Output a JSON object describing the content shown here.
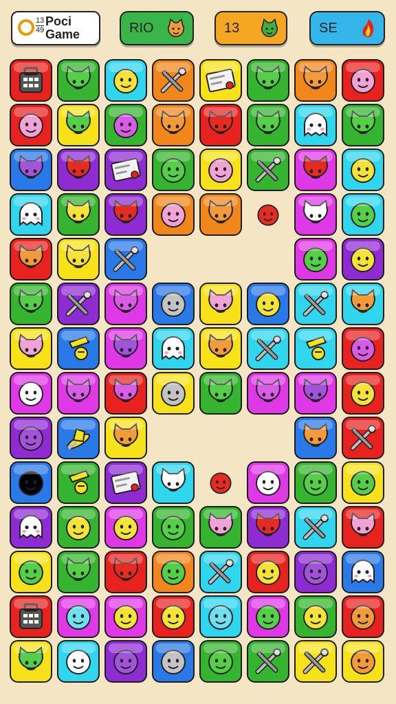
{
  "header": {
    "title_line1": "Poci",
    "title_line2": "Game",
    "logo_score_top": "13",
    "logo_score_bottom": "49",
    "pills": [
      {
        "label": "RIO",
        "color": "#39b54a",
        "icon": "cat-face-icon"
      },
      {
        "label": "13",
        "color": "#f5a623",
        "icon": "cat-face-icon"
      },
      {
        "label": "SE",
        "color": "#35b6ea",
        "icon": "flame-icon"
      }
    ]
  },
  "colors": {
    "red": "#e8231f",
    "green": "#35b52f",
    "cyan": "#2fd6ee",
    "orange": "#f1861b",
    "yellow": "#f7e21a",
    "magenta": "#df38e6",
    "purple": "#8e2bd3",
    "blue": "#2a79e8",
    "face_yellow": "#f6e338",
    "face_pink": "#f2a3d6",
    "face_white": "#ffffff",
    "face_grey": "#c3c3c3",
    "face_orange": "#f39a3a",
    "face_green": "#55cf48",
    "face_red": "#e62b22",
    "face_magenta": "#d85ce6",
    "face_purple": "#a153d9",
    "face_cyan": "#6fe0f0"
  },
  "board": {
    "rows": [
      [
        [
          "red",
          "icon-bag"
        ],
        [
          "green",
          "cat-face",
          "face_green"
        ],
        [
          "cyan",
          "smile-face",
          "face_yellow"
        ],
        [
          "orange",
          "icon-tools"
        ],
        [
          "yellow",
          "icon-card"
        ],
        [
          "green",
          "cat-face",
          "face_green"
        ],
        [
          "orange",
          "cat-face",
          "face_orange"
        ],
        [
          "red",
          "smile-face",
          "face_pink"
        ]
      ],
      [
        [
          "red",
          "smile-face",
          "face_pink"
        ],
        [
          "yellow",
          "cat-face",
          "face_green"
        ],
        [
          "green",
          "smile-face",
          "face_magenta"
        ],
        [
          "orange",
          "cat-face",
          "face_orange"
        ],
        [
          "red",
          "cat-face",
          "face_red"
        ],
        [
          "green",
          "cat-face",
          "face_green"
        ],
        [
          "cyan",
          "ghost-face",
          "face_white"
        ],
        [
          "green",
          "cat-face",
          "face_green"
        ]
      ],
      [
        [
          "blue",
          "cat-face",
          "face_purple"
        ],
        [
          "purple",
          "cat-face",
          "face_red"
        ],
        [
          "purple",
          "icon-card"
        ],
        [
          "green",
          "smile-face",
          "face_green"
        ],
        [
          "yellow",
          "smile-face",
          "face_pink"
        ],
        [
          "green",
          "icon-tools"
        ],
        [
          "magenta",
          "cat-face",
          "face_red"
        ],
        [
          "cyan",
          "smile-face",
          "face_yellow"
        ]
      ],
      [
        [
          "cyan",
          "ghost-face",
          "face_white"
        ],
        [
          "green",
          "cat-face",
          "face_yellow"
        ],
        [
          "purple",
          "cat-face",
          "face_red"
        ],
        [
          "orange",
          "smile-face",
          "face_pink"
        ],
        [
          "orange",
          "cat-face",
          "face_orange"
        ],
        null,
        [
          "magenta",
          "cat-face",
          "face_white"
        ],
        [
          "cyan",
          "smile-face",
          "face_green"
        ]
      ],
      [
        [
          "red",
          "cat-face",
          "face_orange"
        ],
        [
          "yellow",
          "cat-face",
          "face_yellow"
        ],
        [
          "blue",
          "icon-tools"
        ],
        null,
        null,
        null,
        [
          "magenta",
          "smile-face",
          "face_green"
        ],
        [
          "purple",
          "smile-face",
          "face_yellow"
        ]
      ],
      [
        [
          "green",
          "cat-face",
          "face_green"
        ],
        [
          "purple",
          "icon-tools"
        ],
        [
          "magenta",
          "cat-face",
          "face_magenta"
        ],
        [
          "blue",
          "smile-face",
          "face_grey"
        ],
        [
          "yellow",
          "cat-face",
          "face_pink"
        ],
        [
          "blue",
          "smile-face",
          "face_yellow"
        ],
        [
          "cyan",
          "icon-tools"
        ],
        [
          "cyan",
          "cat-face",
          "face_orange"
        ]
      ],
      [
        [
          "yellow",
          "cat-face",
          "face_pink"
        ],
        [
          "blue",
          "icon-bell"
        ],
        [
          "magenta",
          "cat-face",
          "face_purple"
        ],
        [
          "cyan",
          "ghost-face",
          "face_white"
        ],
        [
          "yellow",
          "cat-face",
          "face_orange"
        ],
        [
          "cyan",
          "icon-tools"
        ],
        [
          "cyan",
          "icon-bell"
        ],
        [
          "red",
          "smile-face",
          "face_magenta"
        ]
      ],
      [
        [
          "magenta",
          "smile-face",
          "face_white"
        ],
        [
          "magenta",
          "cat-face",
          "face_magenta"
        ],
        [
          "red",
          "cat-face",
          "face_magenta"
        ],
        [
          "yellow",
          "smile-face",
          "face_grey"
        ],
        [
          "green",
          "cat-face",
          "face_green"
        ],
        [
          "magenta",
          "cat-face",
          "face_magenta"
        ],
        [
          "magenta",
          "cat-face",
          "face_purple"
        ],
        [
          "red",
          "smile-face",
          "face_yellow"
        ]
      ],
      [
        [
          "purple",
          "smile-face",
          "face_purple"
        ],
        [
          "blue",
          "icon-hat"
        ],
        [
          "yellow",
          "cat-face",
          "face_orange"
        ],
        null,
        null,
        null,
        [
          "blue",
          "cat-face",
          "face_orange"
        ],
        [
          "red",
          "icon-tools"
        ]
      ],
      [
        [
          "blue",
          "smile-face",
          "face_blue"
        ],
        [
          "green",
          "icon-bell"
        ],
        [
          "purple",
          "icon-card"
        ],
        [
          "cyan",
          "cat-face",
          "face_white"
        ],
        null,
        [
          "magenta",
          "smile-face",
          "face_white"
        ],
        [
          "green",
          "smile-face",
          "face_green"
        ],
        [
          "yellow",
          "smile-face",
          "face_green"
        ]
      ],
      [
        [
          "purple",
          "ghost-face",
          "face_white"
        ],
        [
          "green",
          "smile-face",
          "face_yellow"
        ],
        [
          "magenta",
          "smile-face",
          "face_yellow"
        ],
        [
          "green",
          "smile-face",
          "face_green"
        ],
        [
          "green",
          "cat-face",
          "face_pink"
        ],
        [
          "purple",
          "cat-face",
          "face_red"
        ],
        [
          "cyan",
          "icon-tools"
        ],
        [
          "red",
          "cat-face",
          "face_pink"
        ]
      ],
      [
        [
          "yellow",
          "smile-face",
          "face_green"
        ],
        [
          "green",
          "cat-face",
          "face_green"
        ],
        [
          "red",
          "cat-face",
          "face_red"
        ],
        [
          "orange",
          "smile-face",
          "face_green"
        ],
        [
          "cyan",
          "icon-tools"
        ],
        [
          "red",
          "smile-face",
          "face_yellow"
        ],
        [
          "purple",
          "smile-face",
          "face_purple"
        ],
        [
          "blue",
          "ghost-face",
          "face_white"
        ]
      ],
      [
        [
          "red",
          "icon-bag"
        ],
        [
          "magenta",
          "smile-face",
          "face_cyan"
        ],
        [
          "magenta",
          "smile-face",
          "face_yellow"
        ],
        [
          "red",
          "smile-face",
          "face_yellow"
        ],
        [
          "cyan",
          "smile-face",
          "face_cyan"
        ],
        [
          "magenta",
          "smile-face",
          "face_green"
        ],
        [
          "green",
          "smile-face",
          "face_yellow"
        ],
        [
          "red",
          "smile-face",
          "face_orange"
        ]
      ],
      [
        [
          "yellow",
          "cat-face",
          "face_green"
        ],
        [
          "cyan",
          "smile-face",
          "face_white"
        ],
        [
          "purple",
          "smile-face",
          "face_purple"
        ],
        [
          "blue",
          "smile-face",
          "face_grey"
        ],
        [
          "green",
          "smile-face",
          "face_green"
        ],
        [
          "green",
          "icon-tools"
        ],
        [
          "yellow",
          "icon-tools"
        ],
        [
          "yellow",
          "smile-face",
          "face_orange"
        ]
      ]
    ],
    "loose_pieces": [
      {
        "row": 3,
        "col": 5,
        "kind": "smile-face",
        "fill": "face_red"
      },
      {
        "row": 9,
        "col": 4,
        "kind": "smile-face",
        "fill": "face_red"
      }
    ]
  }
}
